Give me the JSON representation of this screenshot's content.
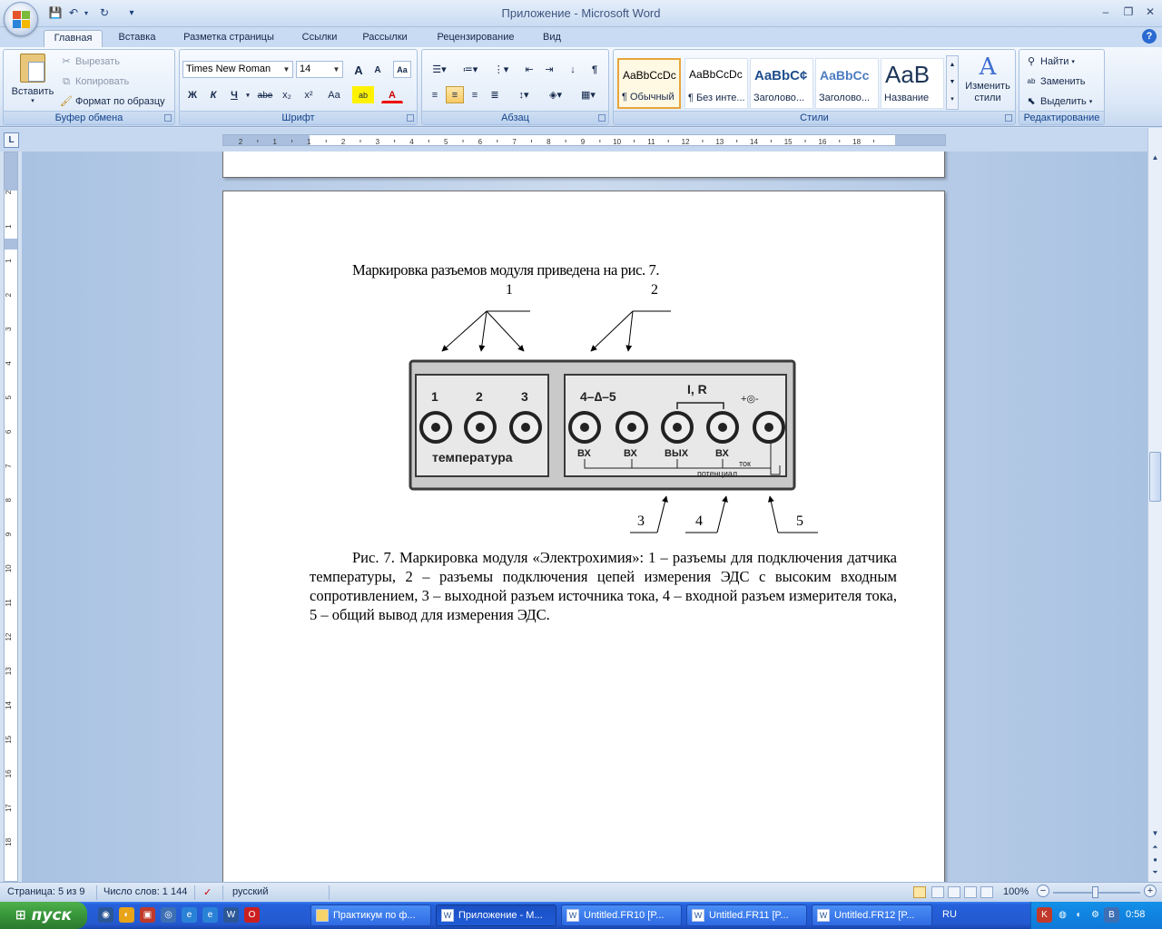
{
  "window": {
    "title": "Приложение - Microsoft Word"
  },
  "tabs": [
    {
      "label": "Главная",
      "active": true
    },
    {
      "label": "Вставка"
    },
    {
      "label": "Разметка страницы"
    },
    {
      "label": "Ссылки"
    },
    {
      "label": "Рассылки"
    },
    {
      "label": "Рецензирование"
    },
    {
      "label": "Вид"
    }
  ],
  "ribbon": {
    "clipboard": {
      "label": "Буфер обмена",
      "paste": "Вставить",
      "cut": "Вырезать",
      "copy": "Копировать",
      "format_painter": "Формат по образцу"
    },
    "font": {
      "label": "Шрифт",
      "font_name": "Times New Roman",
      "font_size": "14",
      "bold": "Ж",
      "italic": "К",
      "underline": "Ч",
      "strike": "abe",
      "subscript": "x₂",
      "superscript": "x²",
      "change_case": "Aa",
      "grow": "A",
      "shrink": "A"
    },
    "paragraph": {
      "label": "Абзац"
    },
    "styles": {
      "label": "Стили",
      "items": [
        {
          "sample": "AaBbCcDc",
          "name": "¶ Обычный"
        },
        {
          "sample": "AaBbCcDc",
          "name": "¶ Без инте..."
        },
        {
          "sample": "AaBbC¢",
          "name": "Заголово..."
        },
        {
          "sample": "AaBbCc",
          "name": "Заголово..."
        },
        {
          "sample": "AaB",
          "name": "Название"
        }
      ],
      "change_styles": "Изменить стили"
    },
    "editing": {
      "label": "Редактирование",
      "find": "Найти",
      "replace": "Заменить",
      "select": "Выделить"
    }
  },
  "ruler": {
    "h_ticks": [
      "2",
      "1",
      "1",
      "2",
      "3",
      "4",
      "5",
      "6",
      "7",
      "8",
      "9",
      "10",
      "11",
      "12",
      "13",
      "14",
      "15",
      "16",
      "18"
    ],
    "v_ticks": [
      "2",
      "1",
      "1",
      "2",
      "3",
      "4",
      "5",
      "6",
      "7",
      "8",
      "9",
      "10",
      "11",
      "12",
      "13",
      "14",
      "15",
      "16",
      "17",
      "18"
    ]
  },
  "document": {
    "intro": "Маркировка разъемов модуля приведена на рис. 7.",
    "figure": {
      "callouts": [
        "1",
        "2",
        "3",
        "4",
        "5"
      ],
      "left_panel": {
        "numbers": [
          "1",
          "2",
          "3"
        ],
        "label": "температура"
      },
      "right_panel": {
        "top_left": "4–∆–5",
        "top_mid": "I, R",
        "top_right": "+◎-",
        "under": [
          "ВХ",
          "ВХ",
          "ВЫХ",
          "ВХ"
        ],
        "tok": "ток",
        "potencial": "потенциал"
      }
    },
    "caption": "Рис. 7. Маркировка модуля «Электрохимия»: 1 – разъемы для подключения датчика температуры, 2 – разъемы подключения цепей измерения ЭДС с высоким входным сопротивлением,  3 – выходной разъем источника тока,  4 – входной разъем измерителя тока, 5 – общий вывод для измерения ЭДС."
  },
  "status": {
    "page": "Страница: 5 из 9",
    "words": "Число слов: 1 144",
    "language": "русский",
    "zoom": "100%"
  },
  "taskbar": {
    "start": "пуск",
    "buttons": [
      {
        "label": "Практикум по ф..."
      },
      {
        "label": "Приложение - M...",
        "active": true
      },
      {
        "label": "Untitled.FR10 [P..."
      },
      {
        "label": "Untitled.FR11 [P..."
      },
      {
        "label": "Untitled.FR12 [P..."
      }
    ],
    "lang": "RU",
    "clock": "0:58"
  }
}
